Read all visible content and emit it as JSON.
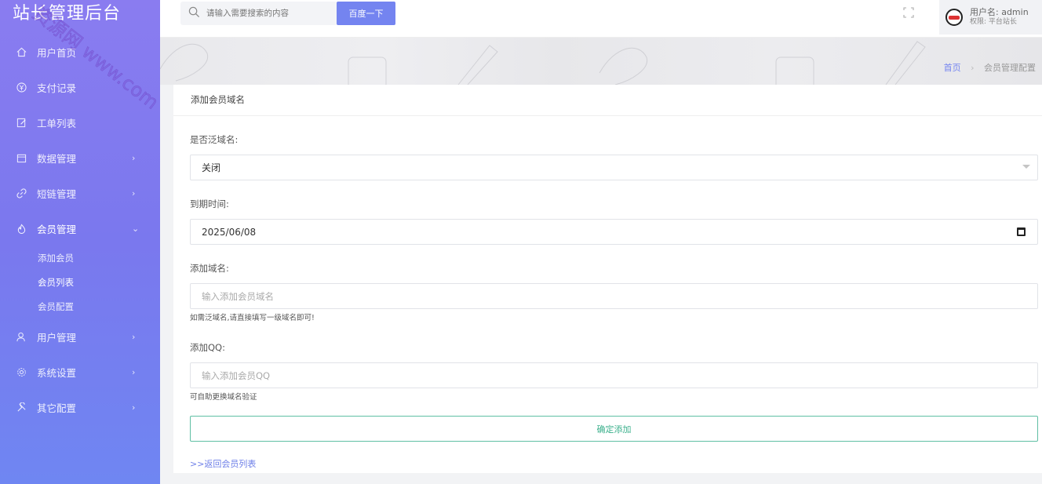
{
  "brand": "站长管理后台",
  "watermark": "资源网 www.com",
  "sidebar": {
    "items": [
      {
        "label": "用户首页",
        "icon": "home-icon"
      },
      {
        "label": "支付记录",
        "icon": "yen-icon"
      },
      {
        "label": "工单列表",
        "icon": "edit-icon"
      },
      {
        "label": "数据管理",
        "icon": "calendar-icon"
      },
      {
        "label": "短链管理",
        "icon": "link-icon"
      },
      {
        "label": "会员管理",
        "icon": "fire-icon"
      },
      {
        "label": "用户管理",
        "icon": "user-icon"
      },
      {
        "label": "系统设置",
        "icon": "gear-icon"
      },
      {
        "label": "其它配置",
        "icon": "tools-icon"
      }
    ],
    "member_sub": [
      "添加会员",
      "会员列表",
      "会员配置"
    ],
    "chevron_right": "›",
    "chevron_down": "⌄"
  },
  "header": {
    "search_placeholder": "请输入需要搜索的内容",
    "search_button": "百度一下",
    "user_name_label": "用户名: admin",
    "user_role_label": "权限: 平台站长"
  },
  "breadcrumb": {
    "home": "首页",
    "sep": "›",
    "current": "会员管理配置"
  },
  "card": {
    "title": "添加会员域名",
    "wildcard_label": "是否泛域名:",
    "wildcard_value": "关闭",
    "expire_label": "到期时间:",
    "expire_value": "2025/06/08",
    "domain_label": "添加域名:",
    "domain_placeholder": "输入添加会员域名",
    "domain_hint": "如需泛域名,请直接填写一级域名即可!",
    "qq_label": "添加QQ:",
    "qq_placeholder": "输入添加会员QQ",
    "qq_hint": "可自助更换域名验证",
    "submit": "确定添加",
    "back": ">>返回会员列表"
  },
  "colors": {
    "accent": "#7484f0",
    "submit_border": "#5fbfa4",
    "submit_text": "#3bb08c"
  }
}
